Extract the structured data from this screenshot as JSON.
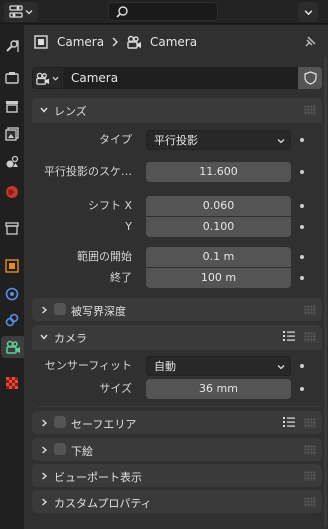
{
  "breadcrumb": {
    "object_name": "Camera",
    "data_name": "Camera"
  },
  "datablock": {
    "name": "Camera"
  },
  "lens": {
    "title": "レンズ",
    "type_label": "タイプ",
    "type_value": "平行投影",
    "ortho_scale_label": "平行投影のスケ…",
    "ortho_scale_value": "11.600",
    "shift_x_label": "シフト X",
    "shift_x_value": "0.060",
    "shift_y_label": "Y",
    "shift_y_value": "0.100",
    "clip_start_label": "範囲の開始",
    "clip_start_value": "0.1 m",
    "clip_end_label": "終了",
    "clip_end_value": "100 m"
  },
  "dof": {
    "title": "被写界深度"
  },
  "camera": {
    "title": "カメラ",
    "sensor_fit_label": "センサーフィット",
    "sensor_fit_value": "自動",
    "size_label": "サイズ",
    "size_value": "36 mm"
  },
  "safe_areas": {
    "title": "セーフエリア"
  },
  "background_images": {
    "title": "下絵"
  },
  "viewport_display": {
    "title": "ビューポート表示"
  },
  "custom_props": {
    "title": "カスタムプロパティ"
  },
  "colors": {
    "accent_camera": "#5fcf9b",
    "accent_orange": "#e5892c",
    "accent_blue": "#5a8fe0"
  },
  "icons": [
    "editor-type-icon",
    "search-icon",
    "wrench-icon",
    "render-icon",
    "output-icon",
    "view-layer-icon",
    "scene-icon",
    "world-icon",
    "collection-icon",
    "object-icon",
    "physics-icon",
    "constraint-icon",
    "camera-data-icon",
    "texture-icon",
    "pin-icon",
    "shield-icon",
    "list-icon"
  ]
}
